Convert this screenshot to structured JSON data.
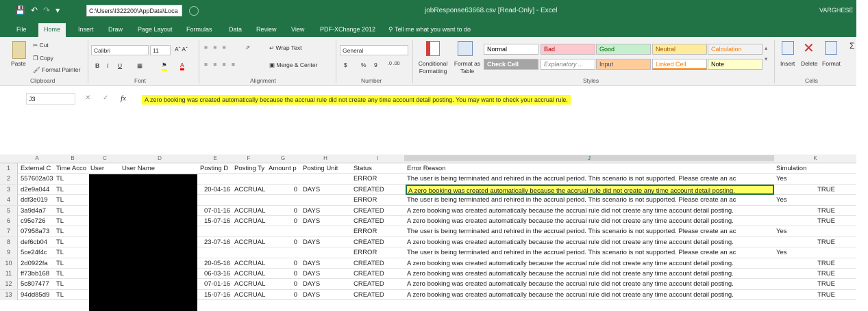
{
  "window": {
    "file_path": "C:\\Users\\I322200\\AppData\\Loca",
    "title": "jobResponse63668.csv [Read-Only] - Excel",
    "user": "VARGHESE"
  },
  "menu": {
    "tabs": [
      "File",
      "Home",
      "Insert",
      "Draw",
      "Page Layout",
      "Formulas",
      "Data",
      "Review",
      "View",
      "PDF-XChange 2012"
    ],
    "tell_me": "Tell me what you want to do"
  },
  "ribbon": {
    "clipboard": {
      "paste": "Paste",
      "cut": "Cut",
      "copy": "Copy",
      "format_painter": "Format Painter",
      "label": "Clipboard"
    },
    "font": {
      "name": "Calibri",
      "size": "11",
      "label": "Font",
      "bold": "B",
      "italic": "I",
      "underline": "U"
    },
    "alignment": {
      "wrap_text": "Wrap Text",
      "merge_center": "Merge & Center",
      "label": "Alignment"
    },
    "number": {
      "format": "General",
      "currency": "$",
      "percent": "%",
      "comma": "9",
      "label": "Number"
    },
    "styles": {
      "conditional": "Conditional Formatting",
      "format_as_table": "Format as Table",
      "cells": [
        {
          "name": "Normal",
          "bg": "#ffffff",
          "color": "#000000"
        },
        {
          "name": "Bad",
          "bg": "#ffc7ce",
          "color": "#9c0006"
        },
        {
          "name": "Good",
          "bg": "#c6efce",
          "color": "#006100"
        },
        {
          "name": "Neutral",
          "bg": "#ffeb9c",
          "color": "#9c5700"
        },
        {
          "name": "Calculation",
          "bg": "#f2f2f2",
          "color": "#fa7d00"
        },
        {
          "name": "Check Cell",
          "bg": "#a5a5a5",
          "color": "#ffffff"
        },
        {
          "name": "Explanatory ...",
          "bg": "#ffffff",
          "color": "#7f7f7f"
        },
        {
          "name": "Input",
          "bg": "#ffcc99",
          "color": "#3f3f76"
        },
        {
          "name": "Linked Cell",
          "bg": "#ffffff",
          "color": "#fa7d00"
        },
        {
          "name": "Note",
          "bg": "#ffffcc",
          "color": "#000000"
        }
      ],
      "label": "Styles"
    },
    "cells": {
      "insert": "Insert",
      "delete": "Delete",
      "format": "Format",
      "label": "Cells"
    }
  },
  "formula_bar": {
    "name_box": "J3",
    "fx": "fx",
    "content": "A zero booking was created automatically because the accrual rule did not create any time account detail posting. You may want to check your accrual rule."
  },
  "columns": [
    "A",
    "B",
    "C",
    "D",
    "E",
    "F",
    "G",
    "H",
    "I",
    "J",
    "K"
  ],
  "headers": {
    "a": "External C",
    "b": "Time Acco",
    "c": "User",
    "d": "User Name",
    "e": "Posting D",
    "f": "Posting Ty",
    "g": "Amount p",
    "h": "Posting Unit",
    "i": "Status",
    "j": "Error Reason",
    "k": "Simulation"
  },
  "rows": [
    {
      "n": "2",
      "a": "557602a03",
      "b": "TL",
      "e": "",
      "f": "",
      "g": "",
      "h": "",
      "i": "ERROR",
      "j": "The user is being terminated and rehired in the accrual period. This scenario is not supported. Please create an ac",
      "k": "Yes",
      "k_align": "left"
    },
    {
      "n": "3",
      "a": "d2e9a044",
      "b": "TL",
      "e": "20-04-16",
      "f": "ACCRUAL",
      "g": "0",
      "h": "DAYS",
      "i": "CREATED",
      "j": "A zero booking was created automatically because the accrual rule did not create any time account detail posting.",
      "k": "TRUE",
      "k_align": "right"
    },
    {
      "n": "4",
      "a": "ddf3e019",
      "b": "TL",
      "e": "",
      "f": "",
      "g": "",
      "h": "",
      "i": "ERROR",
      "j": "The user is being terminated and rehired in the accrual period. This scenario is not supported. Please create an ac",
      "k": "Yes",
      "k_align": "left"
    },
    {
      "n": "5",
      "a": "3a9d4a7",
      "b": "TL",
      "e": "07-01-16",
      "f": "ACCRUAL",
      "g": "0",
      "h": "DAYS",
      "i": "CREATED",
      "j": "A zero booking was created automatically because the accrual rule did not create any time account detail posting.",
      "k": "TRUE",
      "k_align": "right"
    },
    {
      "n": "6",
      "a": "c95e726",
      "b": "TL",
      "e": "15-07-16",
      "f": "ACCRUAL",
      "g": "0",
      "h": "DAYS",
      "i": "CREATED",
      "j": "A zero booking was created automatically because the accrual rule did not create any time account detail posting.",
      "k": "TRUE",
      "k_align": "right"
    },
    {
      "n": "7",
      "a": "07958a73",
      "b": "TL",
      "e": "",
      "f": "",
      "g": "",
      "h": "",
      "i": "ERROR",
      "j": "The user is being terminated and rehired in the accrual period. This scenario is not supported. Please create an ac",
      "k": "Yes",
      "k_align": "left"
    },
    {
      "n": "8",
      "a": "def6cb04",
      "b": "TL",
      "e": "23-07-16",
      "f": "ACCRUAL",
      "g": "0",
      "h": "DAYS",
      "i": "CREATED",
      "j": "A zero booking was created automatically because the accrual rule did not create any time account detail posting.",
      "k": "TRUE",
      "k_align": "right"
    },
    {
      "n": "9",
      "a": "5ce24f4c",
      "b": "TL",
      "e": "",
      "f": "",
      "g": "",
      "h": "",
      "i": "ERROR",
      "j": "The user is being terminated and rehired in the accrual period. This scenario is not supported. Please create an ac",
      "k": "Yes",
      "k_align": "left"
    },
    {
      "n": "10",
      "a": "2d0922fa",
      "b": "TL",
      "e": "20-05-16",
      "f": "ACCRUAL",
      "g": "0",
      "h": "DAYS",
      "i": "CREATED",
      "j": "A zero booking was created automatically because the accrual rule did not create any time account detail posting.",
      "k": "TRUE",
      "k_align": "right"
    },
    {
      "n": "11",
      "a": "ff73bb168",
      "b": "TL",
      "e": "06-03-16",
      "f": "ACCRUAL",
      "g": "0",
      "h": "DAYS",
      "i": "CREATED",
      "j": "A zero booking was created automatically because the accrual rule did not create any time account detail posting.",
      "k": "TRUE",
      "k_align": "right"
    },
    {
      "n": "12",
      "a": "5c807477",
      "b": "TL",
      "e": "07-01-16",
      "f": "ACCRUAL",
      "g": "0",
      "h": "DAYS",
      "i": "CREATED",
      "j": "A zero booking was created automatically because the accrual rule did not create any time account detail posting.",
      "k": "TRUE",
      "k_align": "right"
    },
    {
      "n": "13",
      "a": "94dd85d9",
      "b": "TL",
      "e": "15-07-16",
      "f": "ACCRUAL",
      "g": "0",
      "h": "DAYS",
      "i": "CREATED",
      "j": "A zero booking was created automatically because the accrual rule did not create any time account detail posting.",
      "k": "TRUE",
      "k_align": "right"
    }
  ]
}
